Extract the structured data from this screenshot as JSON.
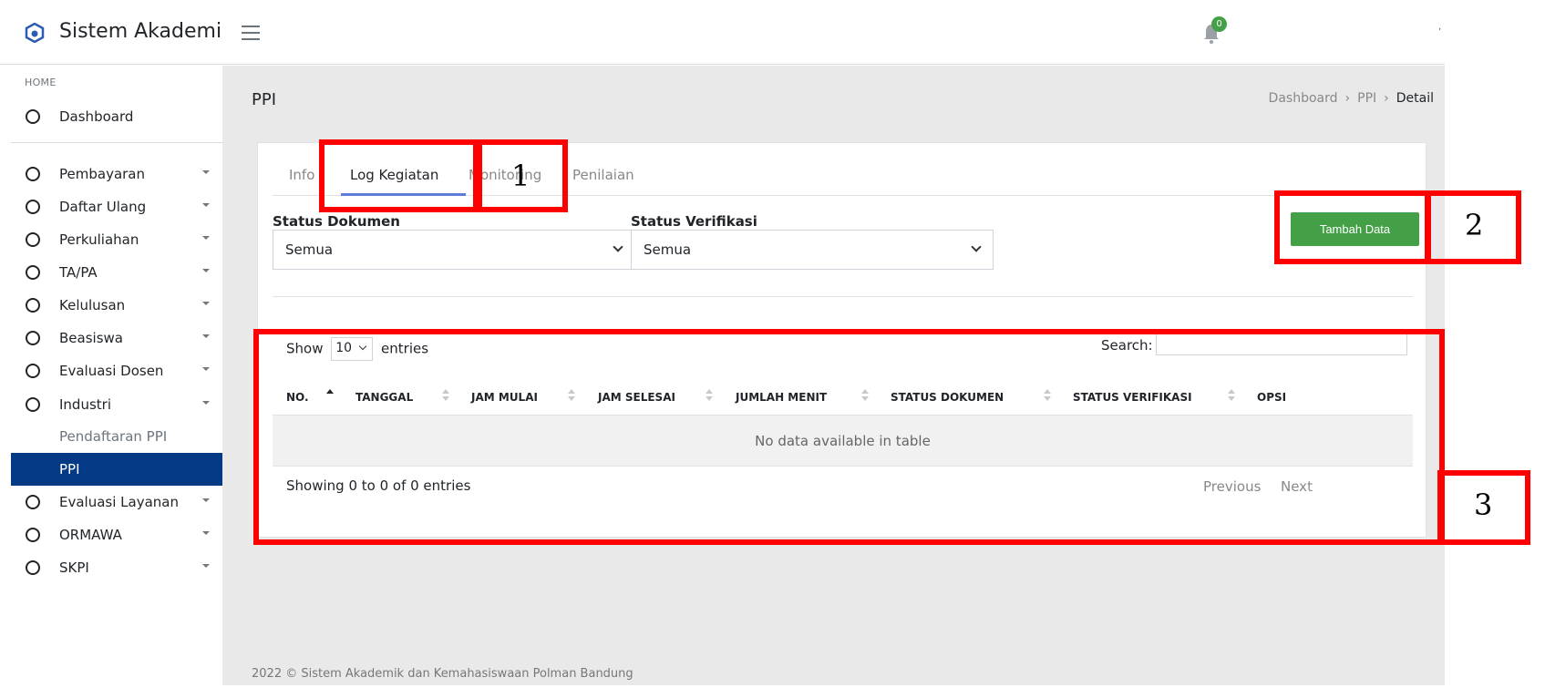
{
  "header": {
    "brand": "Sistem Akademik",
    "notification_count": "0",
    "corner_mark": "ʼ"
  },
  "sidebar": {
    "section": "HOME",
    "dashboard": "Dashboard",
    "items": [
      {
        "label": "Pembayaran"
      },
      {
        "label": "Daftar Ulang"
      },
      {
        "label": "Perkuliahan"
      },
      {
        "label": "TA/PA"
      },
      {
        "label": "Kelulusan"
      },
      {
        "label": "Beasiswa"
      },
      {
        "label": "Evaluasi Dosen"
      },
      {
        "label": "Industri"
      }
    ],
    "subitems": [
      {
        "label": "Pendaftaran PPI"
      },
      {
        "label": "PPI"
      }
    ],
    "items_after": [
      {
        "label": "Evaluasi Layanan"
      },
      {
        "label": "ORMAWA"
      },
      {
        "label": "SKPI"
      }
    ]
  },
  "page": {
    "title": "PPI",
    "breadcrumb": [
      "Dashboard",
      "PPI",
      "Detail"
    ],
    "footer": "2022 © Sistem Akademik dan Kemahasiswaan Polman Bandung"
  },
  "tabs": [
    {
      "label": "Info"
    },
    {
      "label": "Log Kegiatan"
    },
    {
      "label": "Monitoring"
    },
    {
      "label": "Penilaian"
    }
  ],
  "filters": {
    "status_dokumen_label": "Status Dokumen",
    "status_dokumen_value": "Semua",
    "status_verifikasi_label": "Status Verifikasi",
    "status_verifikasi_value": "Semua"
  },
  "add_button": "Tambah Data",
  "table": {
    "show_label": "Show",
    "length_value": "10",
    "entries_label": "entries",
    "search_label": "Search:",
    "columns": [
      "NO.",
      "TANGGAL",
      "JAM MULAI",
      "JAM SELESAI",
      "JUMLAH MENIT",
      "STATUS DOKUMEN",
      "STATUS VERIFIKASI",
      "OPSI"
    ],
    "empty_message": "No data available in table",
    "info": "Showing 0 to 0 of 0 entries",
    "previous": "Previous",
    "next": "Next"
  },
  "annotations": [
    "1",
    "2",
    "3"
  ],
  "colors": {
    "sidebar_active": "#043a85",
    "add_button": "#43a047",
    "annotation": "#ff0000",
    "tab_underline": "#5b7fd6"
  }
}
